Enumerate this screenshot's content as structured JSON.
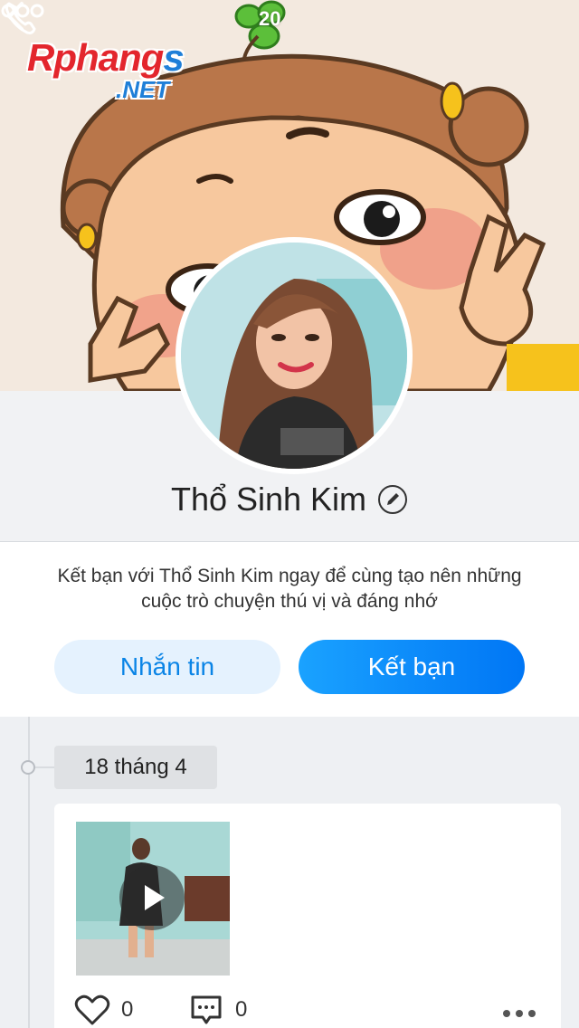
{
  "status_bar": {
    "time": "20"
  },
  "watermark": {
    "line1_main": "Rphang",
    "line1_tail": "s",
    "line2": ".NET"
  },
  "header": {
    "back_icon": "chevron-left-icon",
    "call_icon": "phone-icon",
    "more_icon": "more-dots-icon"
  },
  "profile": {
    "name": "Thổ Sinh Kim",
    "edit_icon": "pencil-icon"
  },
  "friend_prompt": {
    "text": "Kết bạn với Thổ Sinh Kim ngay để cùng tạo nên những cuộc trò chuyện thú vị và đáng nhớ",
    "message_button": "Nhắn tin",
    "add_friend_button": "Kết bạn"
  },
  "timeline": {
    "date": "18 tháng 4",
    "post": {
      "media_type": "video",
      "likes": "0",
      "comments": "0"
    }
  },
  "colors": {
    "accent": "#0a84e6",
    "button_gradient_start": "#1aa2ff",
    "button_gradient_end": "#0076f5",
    "message_button_bg": "#e5f2fe"
  }
}
